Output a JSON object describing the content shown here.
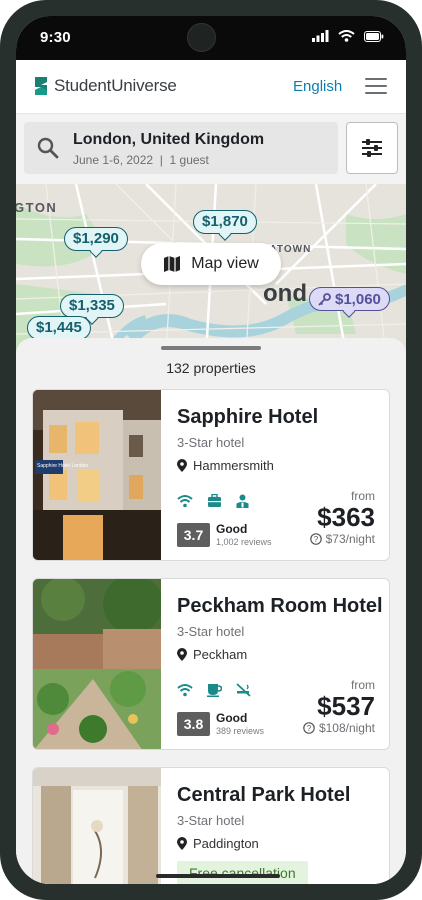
{
  "status": {
    "time": "9:30"
  },
  "header": {
    "brand": "StudentUniverse",
    "language": "English"
  },
  "search": {
    "destination": "London, United Kingdom",
    "details": "June 1-6, 2022  |  1 guest"
  },
  "map": {
    "labels": [
      "GTON",
      "CHINATOWN",
      "ond"
    ],
    "pins": [
      "$1,290",
      "$1,870",
      "$1,335",
      "$1,445",
      "$1,060"
    ],
    "view_button": "Map view"
  },
  "results": {
    "count": "132 properties",
    "hotels": [
      {
        "name": "Sapphire Hotel",
        "stars": "3-Star hotel",
        "location": "Hammersmith",
        "amenities": [
          "wifi-icon",
          "luggage-icon",
          "concierge-icon"
        ],
        "score": "3.7",
        "rating": "Good",
        "reviews": "1,002 reviews",
        "from": "from",
        "price": "$363",
        "per_night": "$73/night",
        "sign": "Sapphire Hotel London"
      },
      {
        "name": "Peckham Room Hotel",
        "stars": "3-Star hotel",
        "location": "Peckham",
        "amenities": [
          "wifi-icon",
          "coffee-icon",
          "no-smoking-icon"
        ],
        "score": "3.8",
        "rating": "Good",
        "reviews": "389 reviews",
        "from": "from",
        "price": "$537",
        "per_night": "$108/night"
      },
      {
        "name": "Central Park Hotel",
        "stars": "3-Star hotel",
        "location": "Paddington",
        "badge": "Free cancellation"
      }
    ]
  },
  "colors": {
    "accent": "#0d7fae",
    "pin": "#14606d",
    "pin_special": "#54509a",
    "frame": "#27302d"
  }
}
